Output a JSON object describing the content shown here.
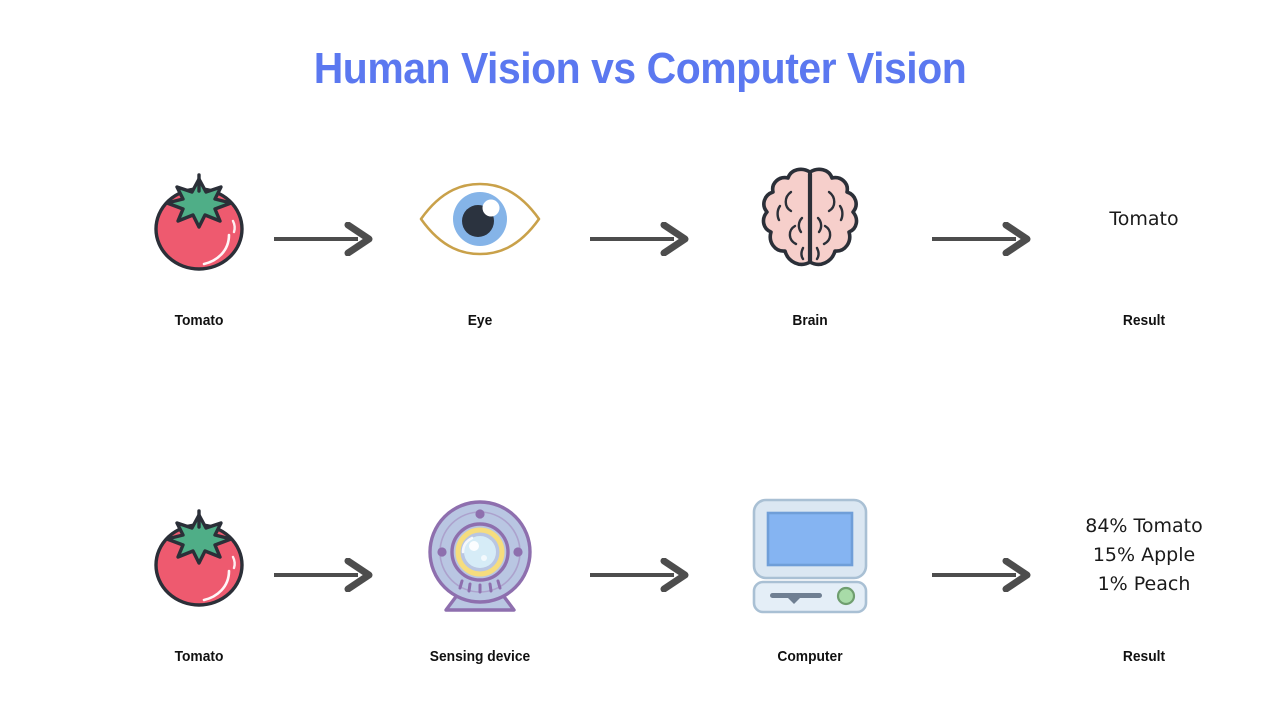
{
  "page": {
    "title": "Human Vision vs Computer Vision",
    "background_color": "#ffffff",
    "title_color": "#5b78f0"
  },
  "colors": {
    "title_blue": "#5b78f0",
    "arrow_gray": "#4d4d4d",
    "tomato_red": "#ee5a6f",
    "tomato_leaf_green": "#4fae87",
    "outline_dark": "#2b2f38",
    "eye_lens_gold": "#c9a14a",
    "eye_iris_blue": "#85b4e8",
    "eye_pupil_navy": "#2b333f",
    "brain_pink": "#f6cfcb",
    "webcam_purple": "#8e6fae",
    "webcam_body_blue": "#b9c6e2",
    "webcam_ring_yellow": "#f6dd7e",
    "webcam_lens_blue": "#d6ecf7",
    "computer_case": "#dbe7f2",
    "computer_screen_blue": "#85b4f2",
    "computer_led_green": "#a8dba8",
    "label_text": "#111111",
    "body_text": "#1a1a1a"
  },
  "rows": [
    {
      "id": "human-vision",
      "stages": [
        {
          "icon": "tomato-icon",
          "label": "Tomato"
        },
        {
          "icon": "eye-icon",
          "label": "Eye"
        },
        {
          "icon": "brain-icon",
          "label": "Brain"
        },
        {
          "icon": "result-text",
          "label": "Result",
          "result_lines": [
            "Tomato"
          ]
        }
      ],
      "arrows": [
        "arrow-right-icon",
        "arrow-right-icon",
        "arrow-right-icon"
      ]
    },
    {
      "id": "computer-vision",
      "stages": [
        {
          "icon": "tomato-icon",
          "label": "Tomato"
        },
        {
          "icon": "webcam-icon",
          "label": "Sensing device"
        },
        {
          "icon": "computer-icon",
          "label": "Computer"
        },
        {
          "icon": "result-text",
          "label": "Result",
          "result_lines": [
            "84% Tomato",
            "15% Apple",
            "1% Peach"
          ]
        }
      ],
      "arrows": [
        "arrow-right-icon",
        "arrow-right-icon",
        "arrow-right-icon"
      ]
    }
  ]
}
